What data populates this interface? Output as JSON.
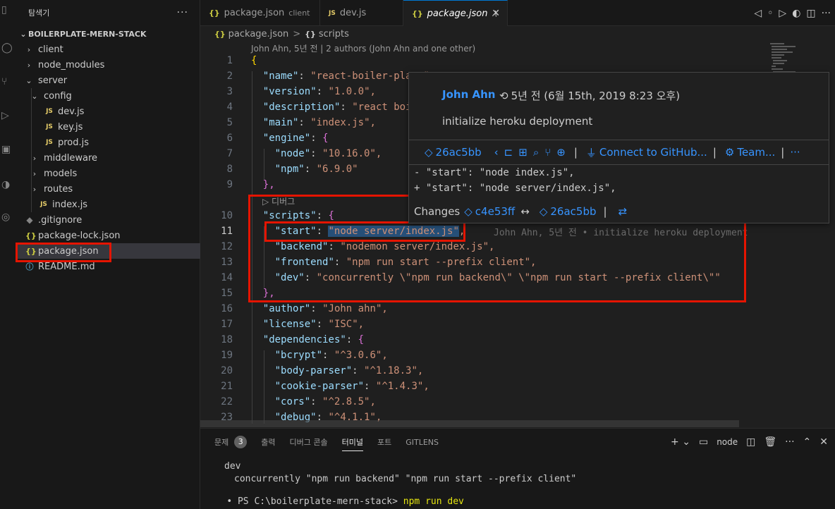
{
  "activity_bar": {
    "icons": [
      "files-icon",
      "search-icon",
      "source-control-icon",
      "run-debug-icon",
      "extensions-icon",
      "remote-icon",
      "gitlens-icon"
    ]
  },
  "explorer": {
    "title": "탐색기",
    "more": "···",
    "root": "BOILERPLATE-MERN-STACK",
    "items": [
      {
        "label": "client",
        "kind": "folder",
        "expanded": false
      },
      {
        "label": "node_modules",
        "kind": "folder",
        "expanded": false
      },
      {
        "label": "server",
        "kind": "folder",
        "expanded": true
      },
      {
        "label": "config",
        "kind": "folder",
        "expanded": true
      },
      {
        "label": "dev.js",
        "kind": "js"
      },
      {
        "label": "key.js",
        "kind": "js"
      },
      {
        "label": "prod.js",
        "kind": "js"
      },
      {
        "label": "middleware",
        "kind": "folder",
        "expanded": false
      },
      {
        "label": "models",
        "kind": "folder",
        "expanded": false
      },
      {
        "label": "routes",
        "kind": "folder",
        "expanded": false
      },
      {
        "label": "index.js",
        "kind": "js"
      },
      {
        "label": ".gitignore",
        "kind": "git"
      },
      {
        "label": "package-lock.json",
        "kind": "json"
      },
      {
        "label": "package.json",
        "kind": "json",
        "selected": true
      },
      {
        "label": "README.md",
        "kind": "info"
      }
    ]
  },
  "tabs": [
    {
      "label": "package.json",
      "desc": "client",
      "icon": "{}",
      "active": false
    },
    {
      "label": "dev.js",
      "desc": "",
      "icon": "JS",
      "active": false
    },
    {
      "label": "package.json",
      "desc": ".\\",
      "icon": "{}",
      "active": true
    }
  ],
  "breadcrumb": {
    "file": "package.json",
    "separator": ">",
    "symbol": "scripts",
    "file_icon": "{}",
    "symbol_icon": "{}"
  },
  "editor": {
    "codelens_top": "John Ahn, 5년 전 | 2 authors (John Ahn and one other)",
    "codelens_debug": "▷ 디버그",
    "current_line": 11,
    "inline_blame": "John Ahn, 5년 전 • initialize heroku deployment",
    "lines": [
      {
        "n": "1",
        "text": "{"
      },
      {
        "n": "2",
        "key": "\"name\"",
        "val": "\"react-boiler-plate\","
      },
      {
        "n": "3",
        "key": "\"version\"",
        "val": "\"1.0.0\","
      },
      {
        "n": "4",
        "key": "\"description\"",
        "val": "\"react boiler plate\","
      },
      {
        "n": "5",
        "key": "\"main\"",
        "val": "\"index.js\","
      },
      {
        "n": "6",
        "key": "\"engine\"",
        "val": "{"
      },
      {
        "n": "7",
        "key": "\"node\"",
        "val": "\"10.16.0\","
      },
      {
        "n": "8",
        "key": "\"npm\"",
        "val": "\"6.9.0\""
      },
      {
        "n": "9",
        "text": "},"
      },
      {
        "n": "10",
        "key": "\"scripts\"",
        "val": "{"
      },
      {
        "n": "11",
        "key": "\"start\"",
        "val": "\"node server/index.js\","
      },
      {
        "n": "12",
        "key": "\"backend\"",
        "val": "\"nodemon server/index.js\","
      },
      {
        "n": "13",
        "key": "\"frontend\"",
        "val": "\"npm run start --prefix client\","
      },
      {
        "n": "14",
        "key": "\"dev\"",
        "val": "\"concurrently \\\"npm run backend\\\" \\\"npm run start --prefix client\\\"\""
      },
      {
        "n": "15",
        "text": "},"
      },
      {
        "n": "16",
        "key": "\"author\"",
        "val": "\"John ahn\","
      },
      {
        "n": "17",
        "key": "\"license\"",
        "val": "\"ISC\","
      },
      {
        "n": "18",
        "key": "\"dependencies\"",
        "val": "{"
      },
      {
        "n": "19",
        "key": "\"bcrypt\"",
        "val": "\"^3.0.6\","
      },
      {
        "n": "20",
        "key": "\"body-parser\"",
        "val": "\"^1.18.3\","
      },
      {
        "n": "21",
        "key": "\"cookie-parser\"",
        "val": "\"^1.4.3\","
      },
      {
        "n": "22",
        "key": "\"cors\"",
        "val": "\"^2.8.5\","
      },
      {
        "n": "23",
        "key": "\"debug\"",
        "val": "\"^4.1.1\","
      }
    ]
  },
  "hover": {
    "author": "John Ahn",
    "time": "5년 전 (6월 15th, 2019 8:23 오후)",
    "message": "initialize heroku deployment",
    "commit": "26ac5bb",
    "connect": "Connect to GitHub...",
    "team": "Team...",
    "more": "···",
    "diff_removed": "- \"start\": \"node index.js\",",
    "diff_added": "+ \"start\": \"node server/index.js\",",
    "changes_label": "Changes",
    "changes_from": "c4e53ff",
    "changes_to": "26ac5bb"
  },
  "panel": {
    "tabs": [
      {
        "label": "문제",
        "badge": "3"
      },
      {
        "label": "출력"
      },
      {
        "label": "디버그 콘솔"
      },
      {
        "label": "터미널",
        "active": true
      },
      {
        "label": "포트"
      },
      {
        "label": "GITLENS"
      }
    ],
    "terminal_name": "node",
    "terminal_lines": {
      "line1": "dev",
      "line2": "concurrently \"npm run backend\" \"npm run start --prefix client\"",
      "prompt": "PS C:\\boilerplate-mern-stack>",
      "command": "npm run dev"
    }
  },
  "colors": {
    "accent": "#0078d4",
    "link": "#3794ff",
    "annotation": "#e51400",
    "selection": "#264f78"
  }
}
